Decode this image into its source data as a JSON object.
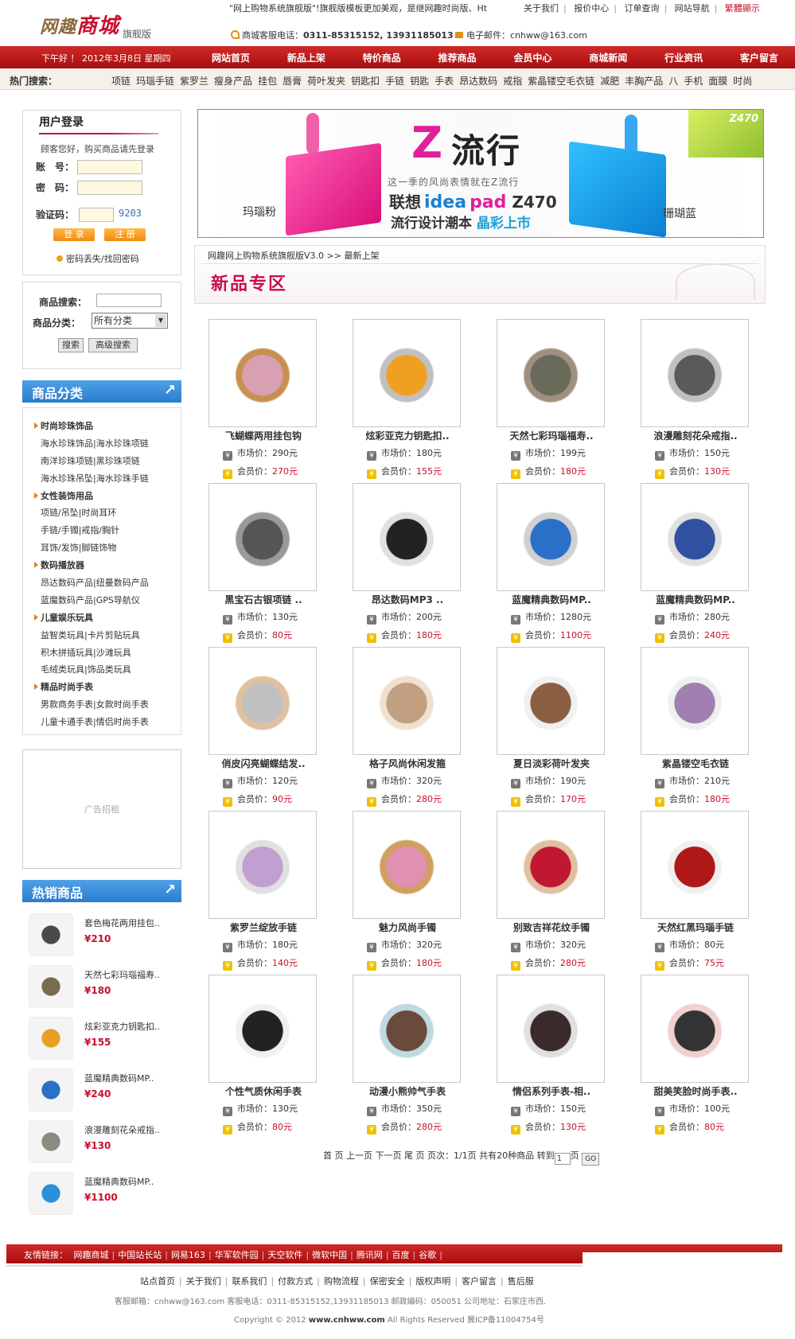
{
  "header": {
    "logo_main": "网趣",
    "logo_accent": "商城",
    "logo_sub": "旗舰版",
    "marquee": "\"网上购物系统旗舰版\"!旗舰版模板更加美观，是继网趣时尚版、Ht",
    "toplinks": [
      "关于我们",
      "报价中心",
      "订单查询",
      "网站导航"
    ],
    "trad_link": "繁體顯示",
    "phone_label": "商城客服电话：",
    "phone": "0311-85315152, 13931185013",
    "email_label": "电子邮件：",
    "email": "cnhww@163.com"
  },
  "nav": {
    "date": "下午好 ！ 2012年3月8日 星期四",
    "items": [
      "网站首页",
      "新品上架",
      "特价商品",
      "推荐商品",
      "会员中心",
      "商城新闻",
      "行业资讯",
      "客户留言"
    ]
  },
  "hot_search": {
    "label": "热门搜索：",
    "words": [
      "项链",
      "玛瑙手链",
      "紫罗兰",
      "瘦身产品",
      "挂包",
      "唇膏",
      "荷叶发夹",
      "钥匙扣",
      "手链",
      "钥匙",
      "手表",
      "昂达数码",
      "戒指",
      "紫晶镂空毛衣链",
      "减肥",
      "丰胸产品",
      "八",
      "手机",
      "面膜",
      "时尚"
    ]
  },
  "login": {
    "title": "用户登录",
    "hint": "顾客您好，购买商品请先登录",
    "account_label": "账　号：",
    "password_label": "密　码：",
    "captcha_label": "验证码：",
    "captcha": "9203",
    "login_btn": "登 录",
    "register_btn": "注 册",
    "forgot": "密码丢失/找回密码"
  },
  "search": {
    "keyword_label": "商品搜索：",
    "category_label": "商品分类：",
    "category_value": "所有分类",
    "search_btn": "搜索",
    "advanced_btn": "高级搜索"
  },
  "categories": {
    "title": "商品分类",
    "rows": [
      {
        "type": "group",
        "text": "时尚珍珠饰品"
      },
      {
        "type": "item",
        "text": "海水珍珠饰品|海水珍珠项链"
      },
      {
        "type": "item",
        "text": "南洋珍珠项链|黑珍珠项链"
      },
      {
        "type": "item",
        "text": "海水珍珠吊坠|海水珍珠手链"
      },
      {
        "type": "group",
        "text": "女性装饰用品"
      },
      {
        "type": "item",
        "text": "项链/吊坠|时尚耳环"
      },
      {
        "type": "item",
        "text": "手链/手镯|戒指/胸针"
      },
      {
        "type": "item",
        "text": "耳饰/发饰|脚链饰物"
      },
      {
        "type": "group",
        "text": "数码播放器"
      },
      {
        "type": "item",
        "text": "昂达数码产品|纽曼数码产品"
      },
      {
        "type": "item",
        "text": "蓝魔数码产品|GPS导航仪"
      },
      {
        "type": "group",
        "text": "儿童娱乐玩具"
      },
      {
        "type": "item",
        "text": "益智类玩具|卡片剪贴玩具"
      },
      {
        "type": "item",
        "text": "积木拼插玩具|沙滩玩具"
      },
      {
        "type": "item",
        "text": "毛绒类玩具|饰品类玩具"
      },
      {
        "type": "group",
        "text": "精品时尚手表"
      },
      {
        "type": "item",
        "text": "男款商务手表|女款时尚手表"
      },
      {
        "type": "item",
        "text": "儿童卡通手表|情侣时尚手表"
      }
    ]
  },
  "ad": {
    "text": "广告招租"
  },
  "hot_products": {
    "title": "热销商品",
    "items": [
      {
        "name": "套色梅花两用挂包..",
        "price": "¥210"
      },
      {
        "name": "天然七彩玛瑙福寿..",
        "price": "¥180"
      },
      {
        "name": "炫彩亚克力钥匙扣..",
        "price": "¥155"
      },
      {
        "name": "蓝魔精典数码MP..",
        "price": "¥240"
      },
      {
        "name": "浪漫雕刻花朵戒指..",
        "price": "¥130"
      },
      {
        "name": "蓝魔精典数码MP..",
        "price": "¥1100"
      }
    ]
  },
  "banner": {
    "z": "Z",
    "z2": "流行",
    "sub": "这一季的风尚表情就在Z流行",
    "brand": "联想",
    "brand_ide": "idea",
    "brand_pad": "pad",
    "model": "Z470",
    "slogan": "流行设计潮本",
    "slogan_accent": "晶彩上市",
    "pink_label": "玛瑙粉",
    "blue_label": "珊瑚蓝",
    "tag": "Z470"
  },
  "breadcrumb": "网趣网上购物系统旗舰版V3.0 >> 最新上架",
  "section_title": "新品专区",
  "price_labels": {
    "market": "市场价：",
    "member": "会员价："
  },
  "products": [
    {
      "name": "飞蝴蝶两用挂包钩",
      "market": "290元",
      "member": "270元"
    },
    {
      "name": "炫彩亚克力钥匙扣..",
      "market": "180元",
      "member": "155元"
    },
    {
      "name": "天然七彩玛瑙福寿..",
      "market": "199元",
      "member": "180元"
    },
    {
      "name": "浪漫雕刻花朵戒指..",
      "market": "150元",
      "member": "130元"
    },
    {
      "name": "黑宝石古银项链 ..",
      "market": "130元",
      "member": "80元"
    },
    {
      "name": "昂达数码MP3 ..",
      "market": "200元",
      "member": "180元"
    },
    {
      "name": "蓝魔精典数码MP..",
      "market": "1280元",
      "member": "1100元"
    },
    {
      "name": "蓝魔精典数码MP..",
      "market": "280元",
      "member": "240元"
    },
    {
      "name": "俏皮闪亮蝴蝶结发..",
      "market": "120元",
      "member": "90元"
    },
    {
      "name": "格子风尚休闲发箍",
      "market": "320元",
      "member": "280元"
    },
    {
      "name": "夏日淡彩荷叶发夹",
      "market": "190元",
      "member": "170元"
    },
    {
      "name": "紫晶镂空毛衣链",
      "market": "210元",
      "member": "180元"
    },
    {
      "name": "紫罗兰绽放手链",
      "market": "180元",
      "member": "140元"
    },
    {
      "name": "魅力风尚手镯",
      "market": "320元",
      "member": "180元"
    },
    {
      "name": "别致吉祥花纹手镯",
      "market": "320元",
      "member": "280元"
    },
    {
      "name": "天然红黑玛瑙手链",
      "market": "80元",
      "member": "75元"
    },
    {
      "name": "个性气质休闲手表",
      "market": "130元",
      "member": "80元"
    },
    {
      "name": "动漫小熊帅气手表",
      "market": "350元",
      "member": "280元"
    },
    {
      "name": "情侣系列手表-相..",
      "market": "150元",
      "member": "130元"
    },
    {
      "name": "甜美笑脸时尚手表..",
      "market": "100元",
      "member": "80元"
    }
  ],
  "pager": {
    "text": "首 页  上一页  下一页  尾 页  页次：1/1页  共有20种商品  转到",
    "page_value": "1",
    "suffix": "页",
    "go": "GO"
  },
  "footer": {
    "links_label": "友情链接：",
    "links": [
      "网趣商城",
      "中国站长站",
      "网易163",
      "华军软件园",
      "天空软件",
      "微软中国",
      "腾讯网",
      "百度",
      "谷歌"
    ],
    "nav": [
      "站点首页",
      "关于我们",
      "联系我们",
      "付款方式",
      "购物流程",
      "保密安全",
      "版权声明",
      "客户留言",
      "售后服"
    ],
    "info": "客服邮箱：cnhww@163.com  客服电话：0311-85315152,13931185013 邮政编码：050051 公司地址：石家庄市西.",
    "copyright": "Copyright © 2012",
    "site": "www.cnhww.com",
    "rights": "All Rights Reserved 冀ICP备11004754号"
  }
}
